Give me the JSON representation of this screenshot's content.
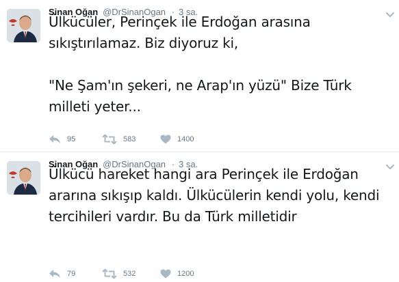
{
  "colors": {
    "text": "#14171a",
    "secondary": "#657786",
    "action_icon": "#aab8c2",
    "divider": "#e1e8ed"
  },
  "tweets": [
    {
      "author_name": "Sinan Oğan",
      "handle": "@DrSinanOgan",
      "separator": "·",
      "time": "3 sa.",
      "text_paragraph_1": "Ülkücüler, Perinçek ile Erdoğan arasına sıkıştırılamaz. Biz diyoruz ki,",
      "text_paragraph_2": "\"Ne Şam'ın şekeri, ne Arap'ın yüzü\" Bize Türk milleti yeter...",
      "reply_count": "95",
      "retweet_count": "583",
      "like_count": "1400",
      "icons": {
        "reply": "reply-icon",
        "retweet": "retweet-icon",
        "like": "heart-icon",
        "menu": "chevron-down-icon"
      }
    },
    {
      "author_name": "Sinan Oğan",
      "handle": "@DrSinanOgan",
      "separator": "·",
      "time": "3 sa.",
      "text_paragraph_1": "Ülkücü hareket hangi ara Perinçek ile Erdoğan ararına sıkışıp kaldı. Ülkücülerin kendi yolu, kendi tercihileri vardır. Bu da Türk milletidir",
      "reply_count": "79",
      "retweet_count": "532",
      "like_count": "1200",
      "icons": {
        "reply": "reply-icon",
        "retweet": "retweet-icon",
        "like": "heart-icon",
        "menu": "chevron-down-icon"
      }
    }
  ]
}
